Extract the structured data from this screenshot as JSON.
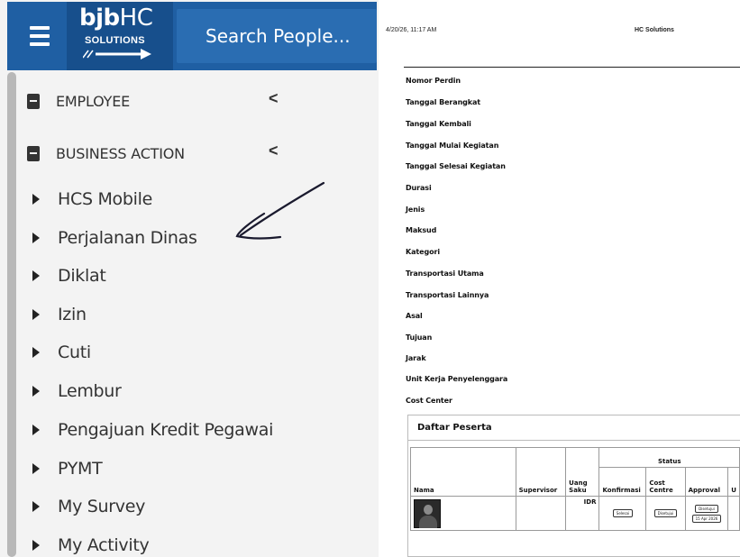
{
  "app": {
    "logo_brand": "bjb",
    "logo_hc": "HC",
    "logo_sub": "SOLUTIONS",
    "search_placeholder": "Search People...",
    "accent": "#1f5fa3"
  },
  "sidebar": {
    "sections": [
      {
        "label": "EMPLOYEE",
        "icon": "folder-icon",
        "chevron": "<"
      },
      {
        "label": "BUSINESS ACTION",
        "icon": "folder-icon",
        "chevron": "<"
      }
    ],
    "items": [
      {
        "label": "HCS Mobile"
      },
      {
        "label": "Perjalanan Dinas"
      },
      {
        "label": "Diklat"
      },
      {
        "label": "Izin"
      },
      {
        "label": "Cuti"
      },
      {
        "label": "Lembur"
      },
      {
        "label": "Pengajuan Kredit Pegawai"
      },
      {
        "label": "PYMT"
      },
      {
        "label": "My Survey"
      },
      {
        "label": "My Activity"
      }
    ]
  },
  "document": {
    "print_datetime": "4/20/26, 11:17 AM",
    "title": "HC Solutions",
    "fields": [
      "Nomor Perdin",
      "Tanggal Berangkat",
      "Tanggal Kembali",
      "Tanggal Mulai Kegiatan",
      "Tanggal Selesai Kegiatan",
      "Durasi",
      "Jenis",
      "Maksud",
      "Kategori",
      "Transportasi Utama",
      "Transportasi Lainnya",
      "Asal",
      "Tujuan",
      "Jarak",
      "Unit Kerja Penyelenggara",
      "Cost Center"
    ],
    "peserta": {
      "title": "Daftar Peserta",
      "status_header": "Status",
      "headers": {
        "nama": "Nama",
        "supervisor": "Supervisor",
        "uang_saku": "Uang Saku",
        "konfirmasi": "Konfirmasi",
        "cost_centre": "Cost Centre",
        "approval": "Approval",
        "extra": "U"
      },
      "row": {
        "currency": "IDR",
        "konfirmasi_chip": "Selesai",
        "cost_centre_chip": "Disetujui",
        "approval_chip": "Disetujui",
        "approval_date": "15 Apr 2026"
      }
    }
  }
}
